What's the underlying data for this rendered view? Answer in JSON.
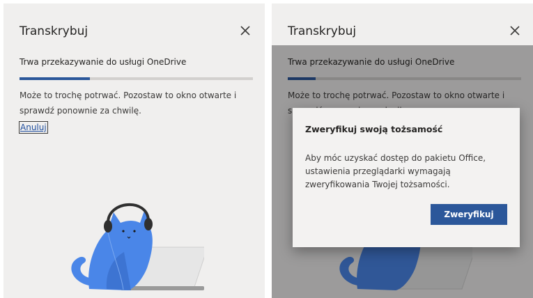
{
  "left_panel": {
    "title": "Transkrybuj",
    "status": "Trwa przekazywanie do usługi OneDrive",
    "progress": 0.3,
    "message": "Może to trochę potrwać. Pozostaw to okno otwarte i sprawdź ponownie za chwilę.",
    "cancel_label": "Anuluj"
  },
  "right_panel": {
    "title": "Transkrybuj",
    "status": "Trwa przekazywanie do usługi OneDrive",
    "progress": 0.12,
    "message": "Może to trochę potrwać. Pozostaw to okno otwarte i sprawdź ponownie za chwilę.",
    "dialog": {
      "title": "Zweryfikuj swoją tożsamość",
      "body": "Aby móc uzyskać dostęp do pakietu Office, ustawienia przeglądarki wymagają zweryfikowania Twojej tożsamości.",
      "button_label": "Zweryfikuj"
    }
  },
  "colors": {
    "accent": "#2b579a",
    "panel_bg": "#f0efee",
    "cat": "#4a86e8"
  },
  "icons": [
    "close-icon",
    "cat-with-headphones-illustration",
    "laptop-illustration"
  ]
}
